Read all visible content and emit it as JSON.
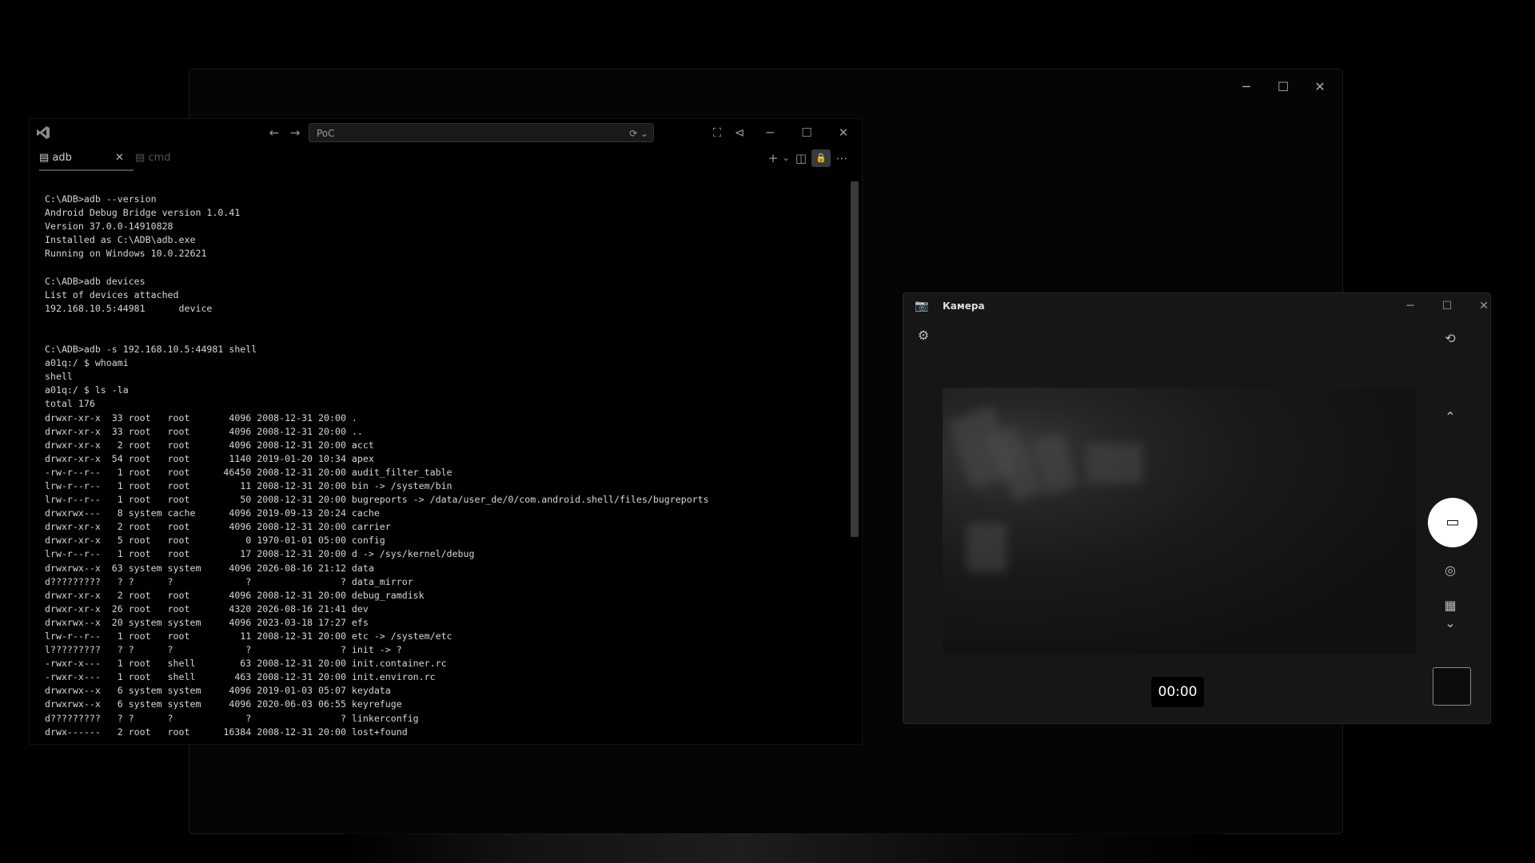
{
  "background_window": {
    "controls": {
      "minimize": "─",
      "maximize": "☐",
      "close": "✕"
    }
  },
  "terminal": {
    "titlebar": {
      "address": "PoC",
      "back": "←",
      "forward": "→",
      "address_icon": "⟳ ⌄",
      "fullscreen": "⛶",
      "pin": "⊲",
      "minimize": "─",
      "maximize": "☐",
      "close": "✕"
    },
    "tabs": [
      {
        "label": "adb",
        "icon": "▤",
        "close": "✕"
      },
      {
        "label": "cmd",
        "icon": "▤"
      }
    ],
    "tabbar_actions": {
      "new_tab": "+",
      "dropdown": "⌄",
      "split": "◫",
      "lock": "🔒",
      "more": "⋯"
    },
    "output": [
      "C:\\ADB>adb --version",
      "Android Debug Bridge version 1.0.41",
      "Version 37.0.0-14910828",
      "Installed as C:\\ADB\\adb.exe",
      "Running on Windows 10.0.22621",
      "",
      "C:\\ADB>adb devices",
      "List of devices attached",
      "192.168.10.5:44981      device",
      "",
      "",
      "C:\\ADB>adb -s 192.168.10.5:44981 shell",
      "a01q:/ $ whoami",
      "shell",
      "a01q:/ $ ls -la",
      "total 176",
      "drwxr-xr-x  33 root   root       4096 2008-12-31 20:00 .",
      "drwxr-xr-x  33 root   root       4096 2008-12-31 20:00 ..",
      "drwxr-xr-x   2 root   root       4096 2008-12-31 20:00 acct",
      "drwxr-xr-x  54 root   root       1140 2019-01-20 10:34 apex",
      "-rw-r--r--   1 root   root      46450 2008-12-31 20:00 audit_filter_table",
      "lrw-r--r--   1 root   root         11 2008-12-31 20:00 bin -> /system/bin",
      "lrw-r--r--   1 root   root         50 2008-12-31 20:00 bugreports -> /data/user_de/0/com.android.shell/files/bugreports",
      "drwxrwx---   8 system cache      4096 2019-09-13 20:24 cache",
      "drwxr-xr-x   2 root   root       4096 2008-12-31 20:00 carrier",
      "drwxr-xr-x   5 root   root          0 1970-01-01 05:00 config",
      "lrw-r--r--   1 root   root         17 2008-12-31 20:00 d -> /sys/kernel/debug",
      "drwxrwx--x  63 system system     4096 2026-08-16 21:12 data",
      "d?????????   ? ?      ?             ?                ? data_mirror",
      "drwxr-xr-x   2 root   root       4096 2008-12-31 20:00 debug_ramdisk",
      "drwxr-xr-x  26 root   root       4320 2026-08-16 21:41 dev",
      "drwxrwx--x  20 system system     4096 2023-03-18 17:27 efs",
      "lrw-r--r--   1 root   root         11 2008-12-31 20:00 etc -> /system/etc",
      "l?????????   ? ?      ?             ?                ? init -> ?",
      "-rwxr-x---   1 root   shell        63 2008-12-31 20:00 init.container.rc",
      "-rwxr-x---   1 root   shell       463 2008-12-31 20:00 init.environ.rc",
      "drwxrwx--x   6 system system     4096 2019-01-03 05:07 keydata",
      "drwxrwx--x   6 system system     4096 2020-06-03 06:55 keyrefuge",
      "d?????????   ? ?      ?             ?                ? linkerconfig",
      "drwx------   2 root   root      16384 2008-12-31 20:00 lost+found"
    ]
  },
  "camera": {
    "title": "Камера",
    "timer": "00:00",
    "icons": {
      "app": "📷",
      "settings": "⚙",
      "switch_camera": "⟲",
      "up": "⌃",
      "record": "▭",
      "photo": "◎",
      "modes": "▦",
      "down": "⌄"
    },
    "controls": {
      "minimize": "─",
      "maximize": "☐",
      "close": "✕"
    }
  }
}
